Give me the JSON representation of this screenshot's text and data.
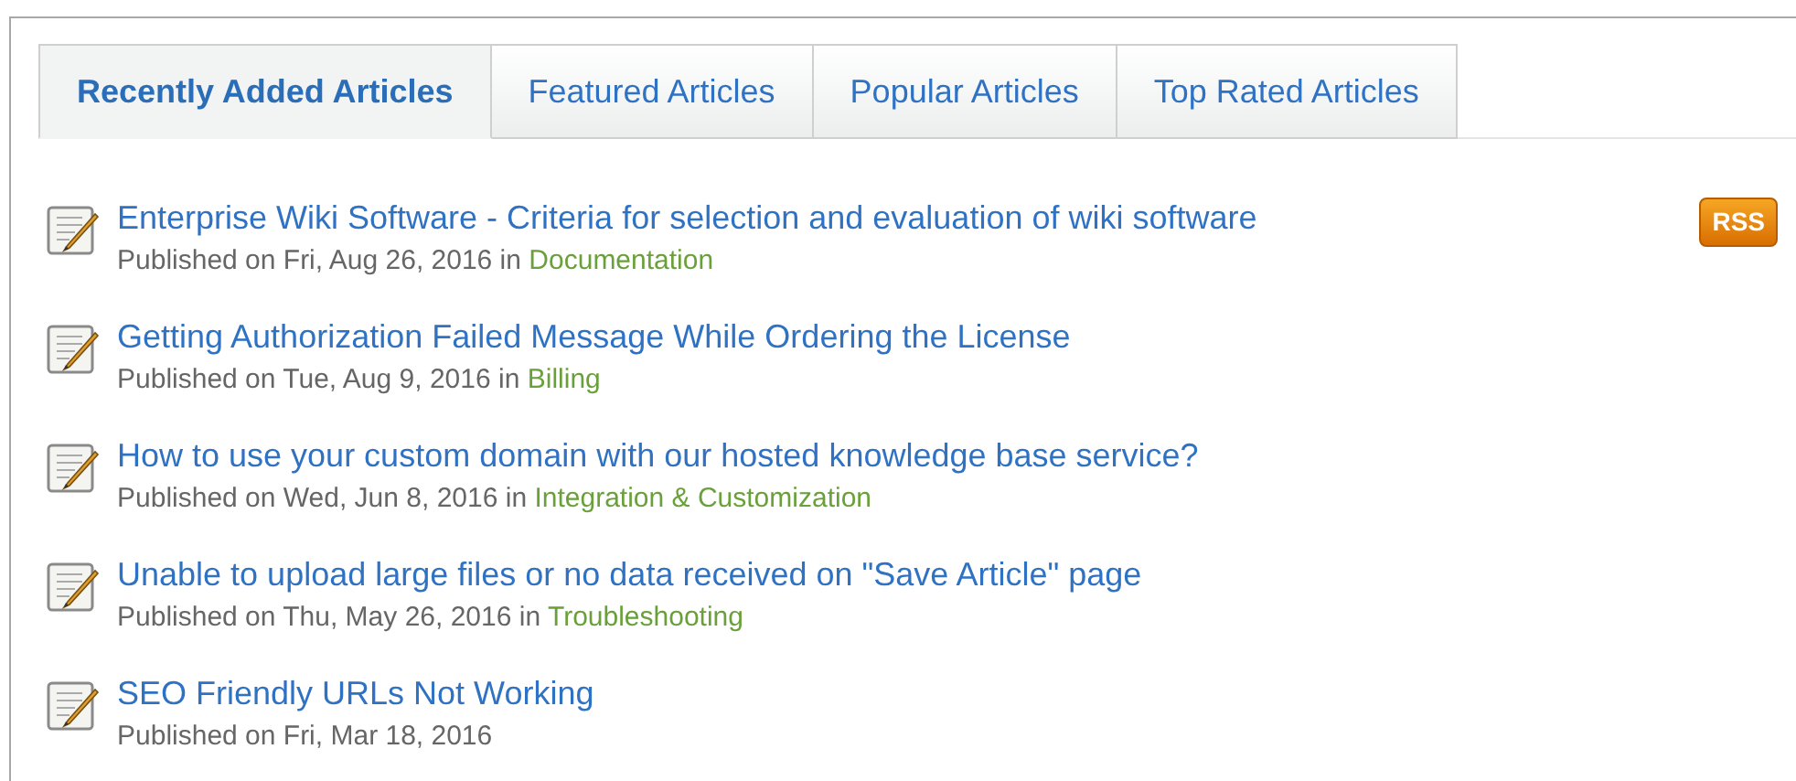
{
  "tabs": [
    {
      "label": "Recently Added Articles",
      "selected": true
    },
    {
      "label": "Featured Articles",
      "selected": false
    },
    {
      "label": "Popular Articles",
      "selected": false
    },
    {
      "label": "Top Rated Articles",
      "selected": false
    }
  ],
  "rss": "RSS",
  "articles": [
    {
      "title": "Enterprise Wiki Software - Criteria for selection and evaluation of wiki software",
      "published": "Published on Fri, Aug 26, 2016 in",
      "category": "Documentation"
    },
    {
      "title": "Getting Authorization Failed Message While Ordering the License",
      "published": "Published on Tue, Aug 9, 2016 in",
      "category": "Billing"
    },
    {
      "title": "How to use your custom domain with our hosted knowledge base service?",
      "published": "Published on Wed, Jun 8, 2016 in",
      "category": "Integration & Customization"
    },
    {
      "title": "Unable to upload large files or no data received on \"Save Article\" page",
      "published": "Published on Thu, May 26, 2016 in",
      "category": "Troubleshooting"
    },
    {
      "title": "SEO Friendly URLs Not Working",
      "published": "Published on Fri, Mar 18, 2016"
    }
  ]
}
